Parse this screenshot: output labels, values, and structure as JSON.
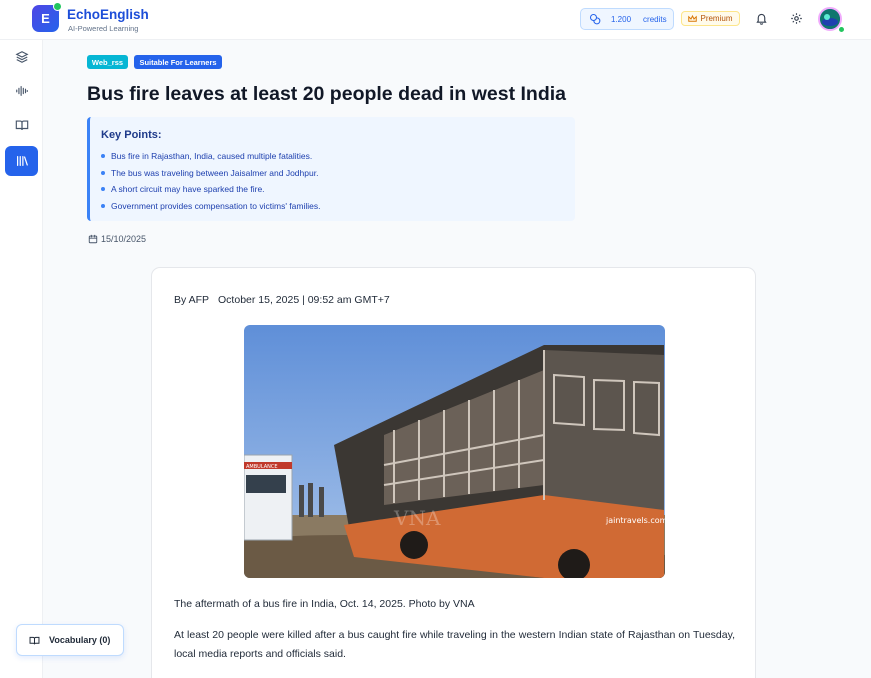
{
  "header": {
    "logo_letter": "E",
    "brand": "EchoEnglish",
    "tagline": "AI-Powered Learning",
    "credits_value": "1.200",
    "credits_label": "credits",
    "premium_label": "Premium"
  },
  "sidebar": {
    "items": [
      {
        "icon": "layers-icon",
        "active": false
      },
      {
        "icon": "audio-wave-icon",
        "active": false
      },
      {
        "icon": "book-open-icon",
        "active": false
      },
      {
        "icon": "library-icon",
        "active": true
      }
    ]
  },
  "article": {
    "tags": [
      "Web_rss",
      "Suitable For Learners"
    ],
    "title": "Bus fire leaves at least 20 people dead in west India",
    "key_points_title": "Key Points:",
    "key_points": [
      "Bus fire in Rajasthan, India, caused multiple fatalities.",
      "The bus was traveling between Jaisalmer and Jodhpur.",
      "A short circuit may have sparked the fire.",
      "Government provides compensation to victims' families."
    ],
    "date": "15/10/2025",
    "author": "By AFP",
    "published": "October 15, 2025 | 09:52 am GMT+7",
    "photo_text": {
      "ambulance": "AMBULANCE",
      "watermark": "VNA",
      "bus_brand": "jaintravels.com"
    },
    "caption": "The aftermath of a bus fire in India, Oct. 14, 2025. Photo by VNA",
    "paragraph": "At least 20 people were killed after a bus caught fire while traveling in the western Indian state of Rajasthan on Tuesday, local media reports and officials said."
  },
  "vocabulary": {
    "label": "Vocabulary (0)"
  },
  "colors": {
    "primary": "#2563eb",
    "tag_web": "#06b6d4",
    "tag_learners": "#2563eb",
    "keypoints_bg": "#eff6ff"
  }
}
